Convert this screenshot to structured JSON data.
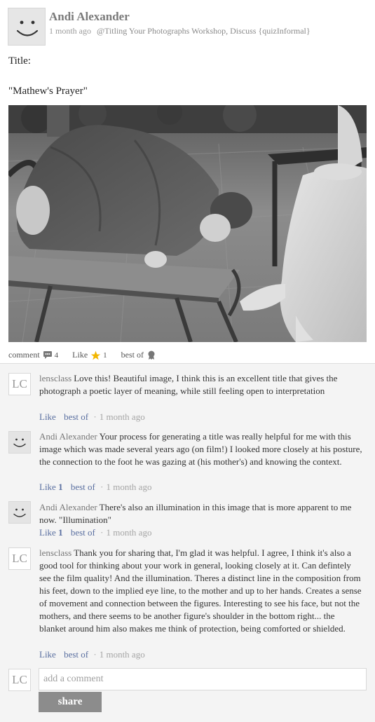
{
  "post": {
    "author": "Andi Alexander",
    "time": "1 month ago",
    "tags": "@Titling Your Photographs Workshop, Discuss {quizInformal}",
    "line1": "Title:",
    "line2": "\"Mathew's Prayer\""
  },
  "actions": {
    "comment_label": "comment",
    "comment_count": "4",
    "like_label": "Like",
    "like_count": "1",
    "bestof_label": "best of",
    "comment_icon": "speech-bubble-icon",
    "like_icon": "star-icon",
    "bestof_icon": "ribbon-icon",
    "star_color": "#f2b600"
  },
  "comments": [
    {
      "avatar": "LC",
      "author": "lensclass",
      "text": "Love this! Beautiful image, I think this is an excellent title that gives the photograph a poetic layer of meaning, while still feeling open to interpretation",
      "like": "Like",
      "like_count": "",
      "bestof": "best of",
      "time": "1 month ago"
    },
    {
      "avatar": "smiley",
      "author": "Andi Alexander",
      "text": "Your process for generating a title was really helpful for me with this image which was made several years ago (on film!) I looked more closely at his posture, the connection to the foot he was gazing at (his mother's) and knowing the context.",
      "like": "Like",
      "like_count": "1",
      "bestof": "best of",
      "time": "1 month ago"
    },
    {
      "avatar": "smiley",
      "author": "Andi Alexander",
      "text": "There's also an illumination in this image that is more apparent to me now. \"Illumination\"",
      "like": "Like",
      "like_count": "1",
      "bestof": "best of",
      "time": "1 month ago"
    },
    {
      "avatar": "LC",
      "author": "lensclass",
      "text": "Thank you for sharing that, I'm glad it was helpful. I agree, I think it's also a good tool for thinking about your work in general, looking closely at it. Can defintely see the film quality! And the illumination. Theres a distinct line in the composition from his feet, down to the implied eye line, to the mother and up to her hands. Creates a sense of movement and connection between the figures. Interesting to see his face, but not the mothers, and there seems to be another figure's shoulder in the bottom right... the blanket around him also makes me think of protection, being comforted or shielded.",
      "like": "Like",
      "like_count": "",
      "bestof": "best of",
      "time": "1 month ago"
    }
  ],
  "compose": {
    "avatar": "LC",
    "placeholder": "add a comment",
    "share_label": "share"
  }
}
